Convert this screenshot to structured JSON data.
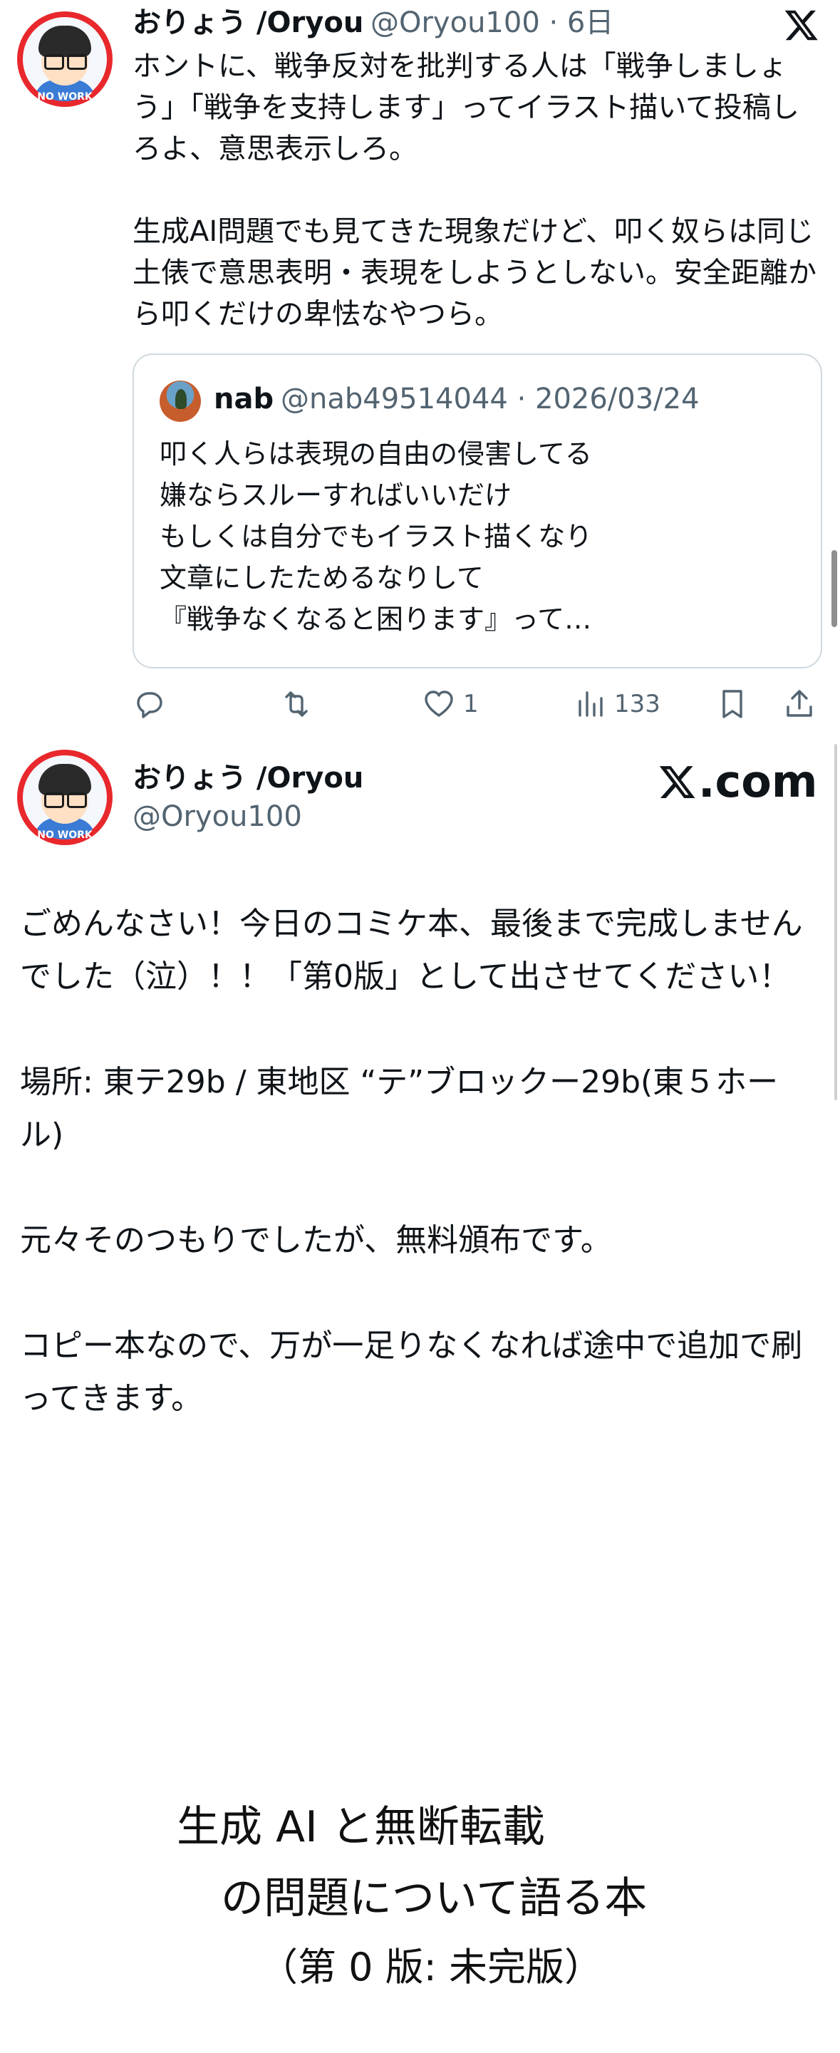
{
  "tweet": {
    "display_name": "おりょう /Oryou",
    "handle_meta": "@Oryou100 · 6日",
    "avatar_badge": "NO WORK",
    "text": "ホントに、戦争反対を批判する人は「戦争しましょう」「戦争を支持します」ってイラスト描いて投稿しろよ、意思表示しろ。\n\n生成AI問題でも見てきた現象だけど、叩く奴らは同じ土俵で意思表明・表現をしようとしない。安全距離から叩くだけの卑怯なやつら。",
    "quote": {
      "display_name": "nab",
      "meta": "@nab49514044 · 2026/03/24",
      "text": "叩く人らは表現の自由の侵害してる\n嫌ならスルーすればいいだけ\nもしくは自分でもイラスト描くなり\n文章にしたためるなりして\n『戦争なくなると困ります』って…"
    },
    "actions": {
      "reply_icon": "reply-icon",
      "retweet_icon": "retweet-icon",
      "like_icon": "heart-icon",
      "like_count": "1",
      "views_icon": "views-icon",
      "views_count": "133",
      "bookmark_icon": "bookmark-icon",
      "share_icon": "share-icon"
    }
  },
  "embedded_post": {
    "display_name": "おりょう /Oryou",
    "handle": "@Oryou100",
    "brand": ".com",
    "text": "ごめんなさい！今日のコミケ本、最後まで完成しませんでした（泣）！！「第0版」として出させてください！\n\n場所: 東テ29b / 東地区 “テ”ブロックー29b(東５ホール)\n\n元々そのつもりでしたが、無料頒布です。\n\nコピー本なので、万が一足りなくなれば途中で追加で刷ってきます。",
    "cover": {
      "line1": "生成 AI と無断転載",
      "line2": "の問題について語る本",
      "line3": "（第 0 版: 未完版）"
    }
  },
  "colors": {
    "text": "#0f1419",
    "muted": "#536471",
    "border": "#cfd9de",
    "avatar_ring": "#e8282c"
  }
}
